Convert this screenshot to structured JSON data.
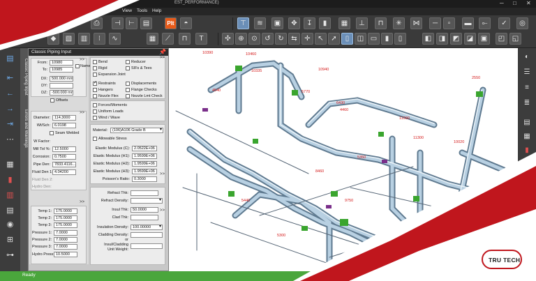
{
  "window": {
    "title_suffix": "EST_PERFORMANCE)",
    "min": "─",
    "max": "□",
    "close": "✕"
  },
  "menu": {
    "view": "View",
    "tools": "Tools",
    "help": "Help"
  },
  "toolbar": {
    "pit_label": "PIt",
    "colors": {
      "accent": "#6b8fb8",
      "pit": "#e85a18"
    }
  },
  "panel": {
    "title": "Classic Piping Input",
    "pin_icon": "pin-icon",
    "vtabs": [
      "Classic Piping Input",
      "Errors and Warnings"
    ],
    "from_label": "From:",
    "from_value": "10980",
    "to_label": "To:",
    "to_value": "10985",
    "name_label": "Name",
    "dx_label": "DX:",
    "dx_value": "500.000 mm",
    "dy_label": "DY:",
    "dy_value": "",
    "dz_label": "DZ:",
    "dz_value": "-500.000 mm",
    "offsets_label": "Offsets",
    "diameter_label": "Diameter:",
    "diameter_value": "114.3000",
    "wt_label": "Wt/Sch:",
    "wt_value": "6.0198",
    "seam_label": "Seam Welded",
    "wfactor_label": "W Factor:",
    "milltol_label": "Mill Tol %:",
    "milltol_value": "12.5000",
    "corrosion_label": "Corrosion:",
    "corrosion_value": "0.7500",
    "pipeden_label": "Pipe Den:",
    "pipeden_value": "7833.4116...",
    "fluidden1_label": "Fluid Den 1:",
    "fluidden1_value": "4.04200",
    "fluidden2_label": "Fluid Den 2:",
    "hydroden_label": "Hydro Den:",
    "temp1_label": "Temp 1:",
    "temp1_value": "175.0000",
    "temp2_label": "Temp 2:",
    "temp2_value": "175.0000",
    "temp3_label": "Temp 3:",
    "temp3_value": "175.0000",
    "press1_label": "Pressure 1:",
    "press1_value": "7.0000",
    "press2_label": "Pressure 2:",
    "press2_value": "7.0000",
    "press3_label": "Pressure 3:",
    "press3_value": "7.0000",
    "hydropress_label": "Hydro Press:",
    "hydropress_value": "10.5000",
    "bend": "Bend",
    "rigid": "Rigid",
    "expansion": "Expansion Joint",
    "reducer": "Reducer",
    "sifs": "SIFs & Tees",
    "restraints": "Restraints",
    "hangers": "Hangers",
    "nozzleflex": "Nozzle Flex",
    "displacements": "Displacements",
    "flangechecks": "Flange Checks",
    "nozzlelimit": "Nozzle Lmt Check",
    "forces": "Forces/Moments",
    "uniform": "Uniform Loads",
    "wind": "Wind / Wave",
    "material_label": "Material:",
    "material_value": "(106)A106 Grade B",
    "allowable": "Allowable Stress",
    "emc_label": "Elastic Modulus (C):",
    "emc_value": "2.0522E+06",
    "emh1_label": "Elastic Modulus (H1):",
    "emh1_value": "1.9599E+06",
    "emh2_label": "Elastic Modulus (H2):",
    "emh2_value": "1.9599E+06",
    "emh3_label": "Elastic Modulus (H3):",
    "emh3_value": "1.9599E+06",
    "poisson_label": "Poisson's Ratio:",
    "poisson_value": "0.3000",
    "refthk_label": "Refract Thk:",
    "refden_label": "Refract Density:",
    "insulthk_label": "Insul Thk:",
    "insulthk_value": "50.0000",
    "cladthk_label": "Clad Thk:",
    "insulden_label": "Insulation Density:",
    "insulden_value": "100.00000",
    "cladden_label": "Cladding Density:",
    "or_label": "or",
    "insulclad_label": "Insul/Cladding",
    "unitweight_label": "Unit Weight:",
    "more": ">>"
  },
  "model_labels": [
    "10940",
    "10460",
    "4540",
    "5770",
    "2550",
    "11000",
    "10335",
    "6430",
    "11300",
    "10020",
    "10390",
    "10560",
    "4460",
    "5440",
    "8460",
    "9750",
    "5350",
    "5300",
    "10730"
  ],
  "status": {
    "text": "Ready"
  },
  "logo": {
    "text": "TRU TECH"
  }
}
